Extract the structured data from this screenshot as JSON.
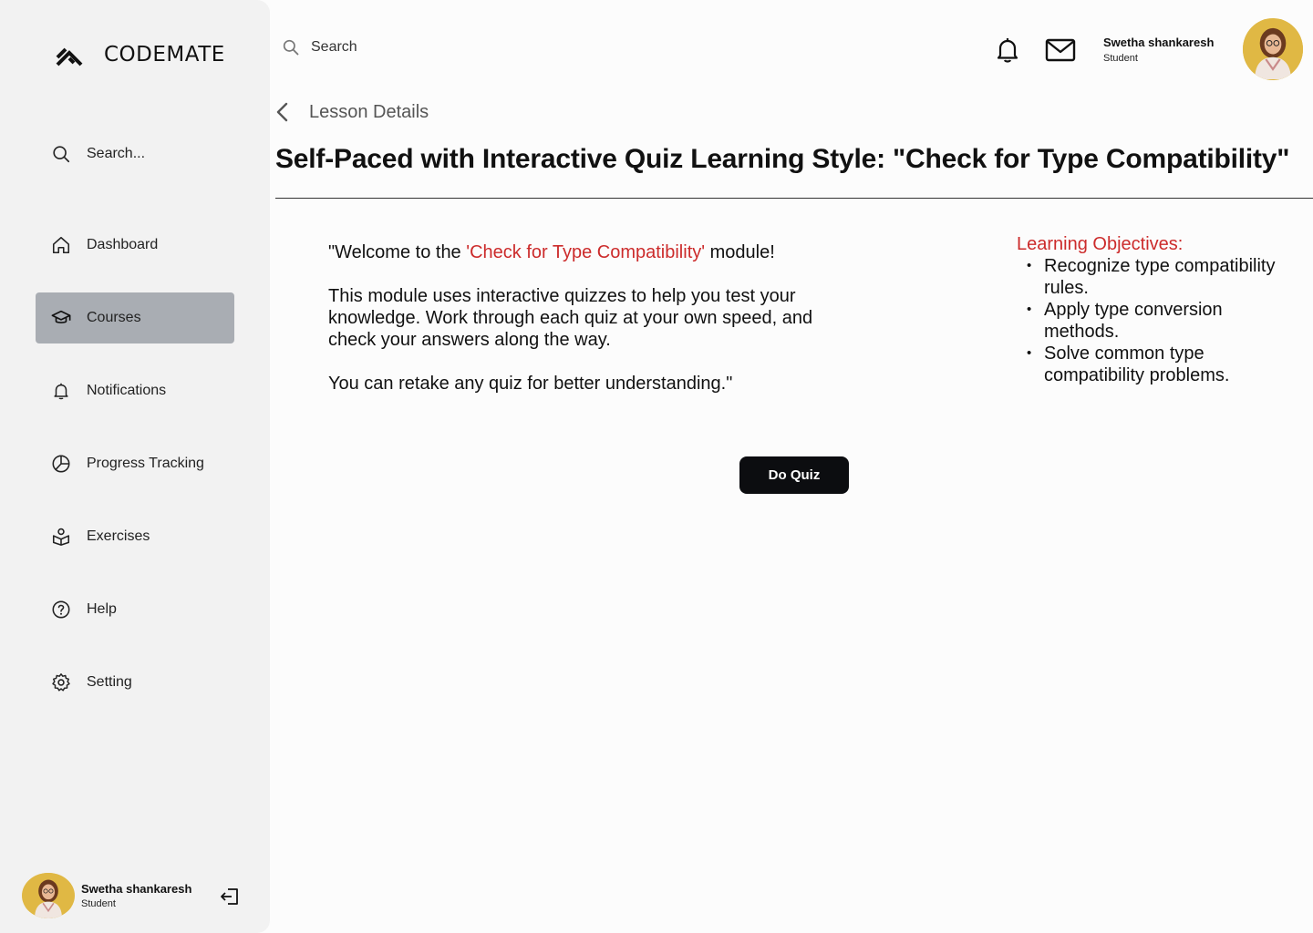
{
  "brand": {
    "name": "CODEMATE"
  },
  "sidebar": {
    "search_placeholder": "Search...",
    "items": [
      {
        "label": "Dashboard",
        "icon": "home-icon",
        "active": false
      },
      {
        "label": "Courses",
        "icon": "graduation-cap-icon",
        "active": true
      },
      {
        "label": "Notifications",
        "icon": "bell-icon",
        "active": false
      },
      {
        "label": "Progress Tracking",
        "icon": "pie-chart-icon",
        "active": false
      },
      {
        "label": "Exercises",
        "icon": "exercises-icon",
        "active": false
      },
      {
        "label": "Help",
        "icon": "help-circle-icon",
        "active": false
      },
      {
        "label": "Setting",
        "icon": "gear-icon",
        "active": false
      }
    ]
  },
  "user": {
    "name": "Swetha shankaresh",
    "role": "Student"
  },
  "topbar": {
    "search_placeholder": "Search"
  },
  "breadcrumb": {
    "label": "Lesson Details"
  },
  "lesson": {
    "title": "Self-Paced with Interactive Quiz Learning Style: \"Check for Type Compatibility\"",
    "intro_pre": "\"Welcome to the ",
    "intro_highlight": "'Check for Type Compatibility'",
    "intro_post": " module!",
    "paragraph_2": "This module uses interactive quizzes to help you test your knowledge. Work through each quiz at your own speed, and check your answers along the way.",
    "paragraph_3": "You can retake any quiz for better understanding.\"",
    "objectives_title": "Learning Objectives:",
    "objectives": [
      "Recognize type compatibility rules.",
      "Apply type conversion methods.",
      "Solve common type compatibility problems."
    ],
    "quiz_button": "Do Quiz"
  },
  "colors": {
    "sidebar_bg": "#f2f2f2",
    "active_item_bg": "#a9adb3",
    "highlight_red": "#cc2b2b",
    "button_bg": "#0c0d10",
    "avatar_bg": "#e0b844"
  }
}
